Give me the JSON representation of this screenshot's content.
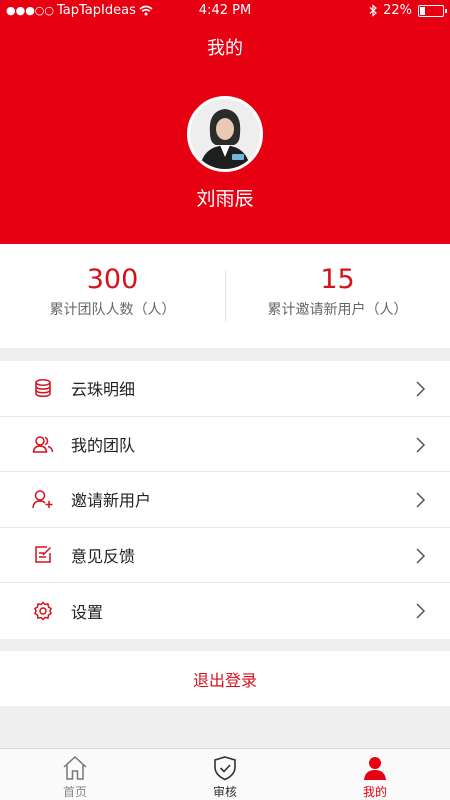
{
  "status_bar": {
    "carrier": "TapTapIdeas",
    "time": "4:42 PM",
    "battery": "22%",
    "battery_level": 0.22
  },
  "header": {
    "title": "我的",
    "user_name": "刘雨辰"
  },
  "stats": [
    {
      "value": "300",
      "label": "累计团队人数（人）"
    },
    {
      "value": "15",
      "label": "累计邀请新用户（人）"
    }
  ],
  "menu": [
    {
      "label": "云珠明细",
      "icon": "coins-icon"
    },
    {
      "label": "我的团队",
      "icon": "team-icon"
    },
    {
      "label": "邀请新用户",
      "icon": "add-user-icon"
    },
    {
      "label": "意见反馈",
      "icon": "feedback-icon"
    },
    {
      "label": "设置",
      "icon": "settings-icon"
    }
  ],
  "logout_label": "退出登录",
  "tabs": [
    {
      "label": "首页",
      "icon": "home-icon"
    },
    {
      "label": "审核",
      "icon": "shield-check-icon"
    },
    {
      "label": "我的",
      "icon": "profile-icon",
      "active": true
    }
  ],
  "colors": {
    "brand": "#e60012",
    "accent_text": "#d6111e"
  }
}
